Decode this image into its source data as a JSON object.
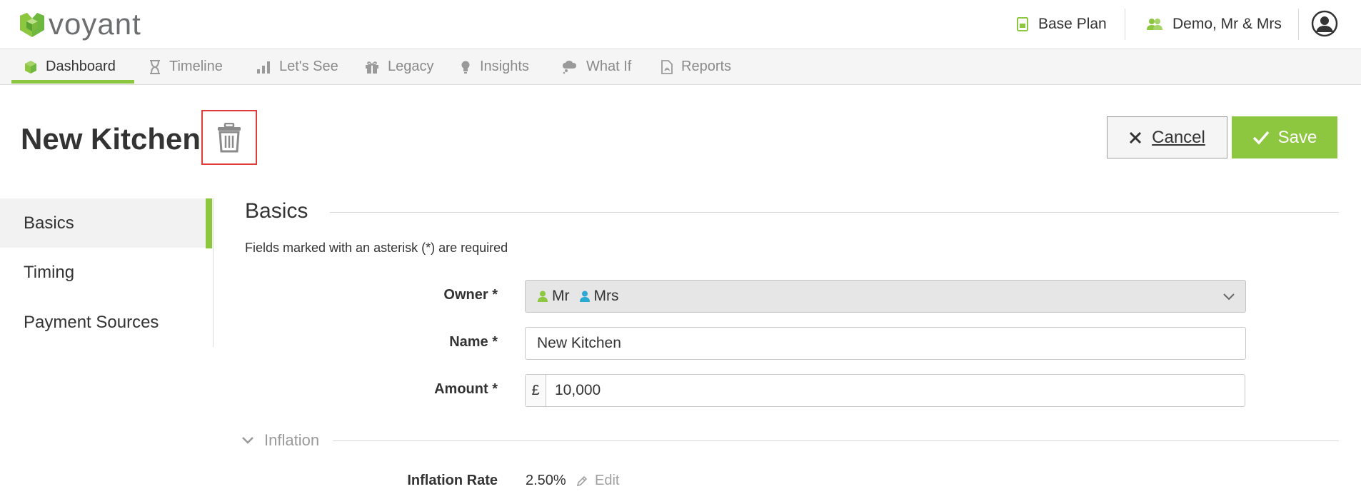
{
  "brand": {
    "name": "voyant",
    "accent": "#8dc63f",
    "highlight": "#e03c3c"
  },
  "topbar": {
    "plan": {
      "label": "Base Plan",
      "icon": "plan-document-icon"
    },
    "client": {
      "label": "Demo, Mr & Mrs",
      "icon": "people-icon"
    },
    "account_icon": "user-circle-icon"
  },
  "nav": {
    "items": [
      {
        "label": "Dashboard",
        "icon": "cube-icon",
        "active": true
      },
      {
        "label": "Timeline",
        "icon": "hourglass-icon",
        "active": false
      },
      {
        "label": "Let's See",
        "icon": "bar-chart-icon",
        "active": false
      },
      {
        "label": "Legacy",
        "icon": "gift-icon",
        "active": false
      },
      {
        "label": "Insights",
        "icon": "lightbulb-icon",
        "active": false
      },
      {
        "label": "What If",
        "icon": "thought-cloud-icon",
        "active": false
      },
      {
        "label": "Reports",
        "icon": "pdf-file-icon",
        "active": false
      }
    ]
  },
  "page": {
    "title": "New Kitchen",
    "delete_icon": "trash-icon",
    "cancel_label": "Cancel",
    "save_label": "Save"
  },
  "side_menu": {
    "items": [
      {
        "label": "Basics",
        "active": true
      },
      {
        "label": "Timing",
        "active": false
      },
      {
        "label": "Payment Sources",
        "active": false
      }
    ]
  },
  "form": {
    "section_title": "Basics",
    "required_note": "Fields marked with an asterisk (*) are required",
    "owner": {
      "label": "Owner *",
      "values": [
        "Mr",
        "Mrs"
      ],
      "colors": [
        "#8dc63f",
        "#2aa9d2"
      ]
    },
    "name": {
      "label": "Name *",
      "value": "New Kitchen"
    },
    "amount": {
      "label": "Amount *",
      "prefix": "£",
      "value": "10,000"
    },
    "inflation": {
      "header": "Inflation",
      "rate_label": "Inflation Rate",
      "rate_value": "2.50%",
      "edit_label": "Edit"
    }
  }
}
